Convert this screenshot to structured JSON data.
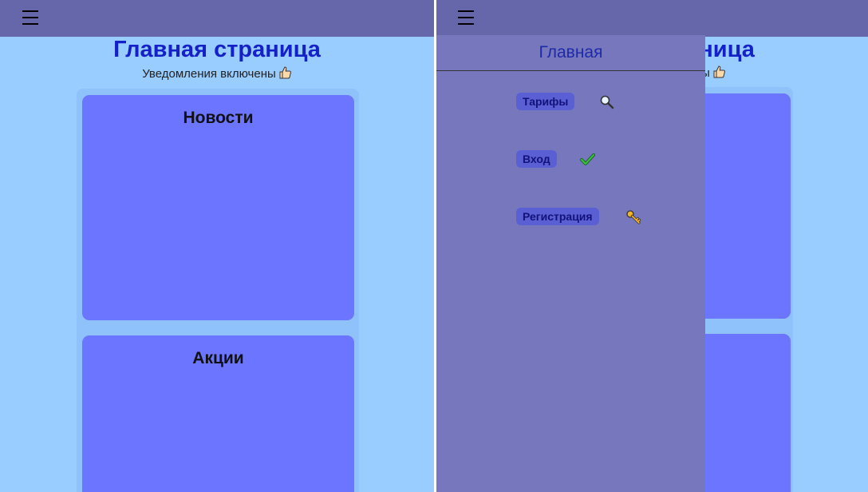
{
  "page": {
    "title": "Главная страница",
    "subtitle": "Уведомления включены",
    "subtitle_icon": "thumbs-up-icon",
    "cards": [
      {
        "title": "Новости"
      },
      {
        "title": "Акции"
      }
    ]
  },
  "nav": {
    "menu_icon": "hamburger-menu-icon",
    "drawer_title": "Главная",
    "items": [
      {
        "label": "Тарифы",
        "icon": "magnifier-icon"
      },
      {
        "label": "Вход",
        "icon": "checkmark-icon"
      },
      {
        "label": "Регистрация",
        "icon": "key-icon"
      }
    ]
  },
  "colors": {
    "header": "#6666aa",
    "background": "#99ccff",
    "card": "#6b75ff",
    "title": "#1420c8",
    "drawer": "#7777bd",
    "menu_badge": "#5a5fd4"
  }
}
